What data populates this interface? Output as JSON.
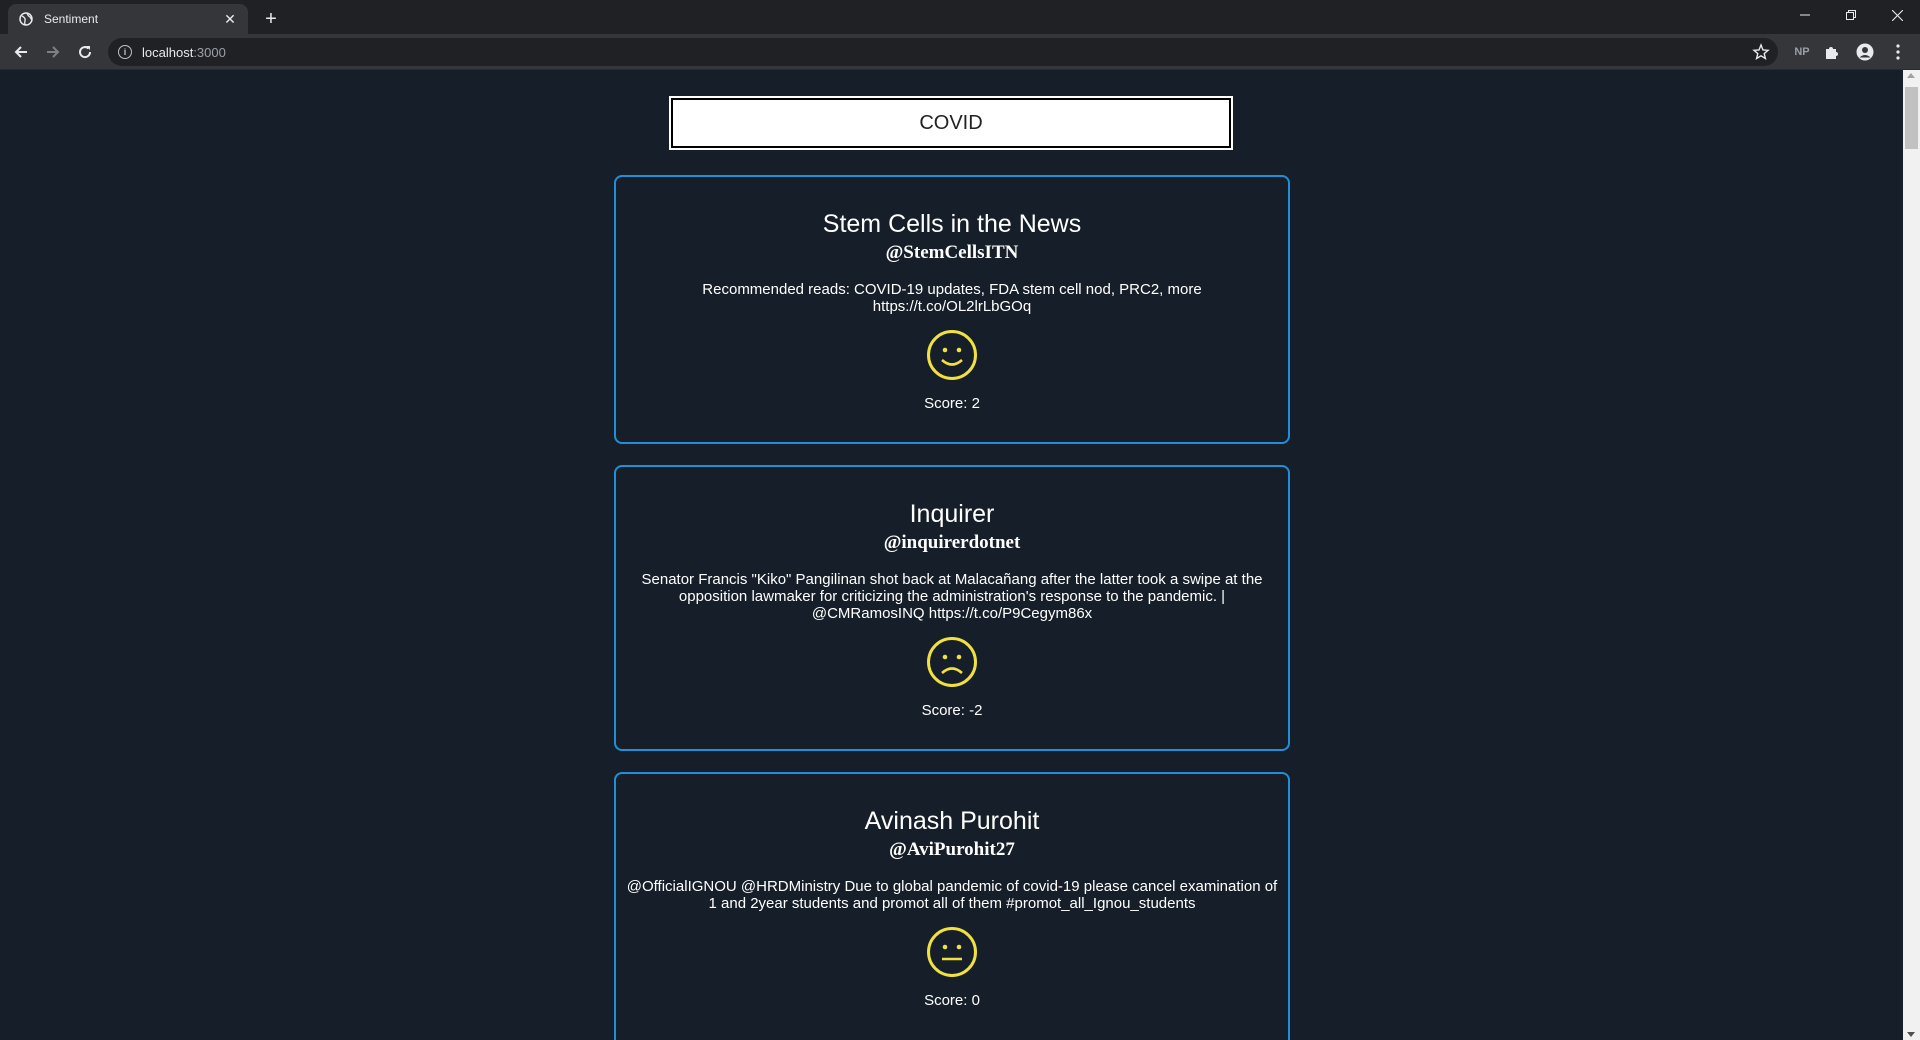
{
  "browser": {
    "tab_title": "Sentiment",
    "url_host": "localhost",
    "url_port": ":3000",
    "profile_badge": "NP"
  },
  "search": {
    "value": "COVID"
  },
  "tweets": [
    {
      "name": "Stem Cells in the News",
      "handle": "@StemCellsITN",
      "text": "Recommended reads: COVID-19 updates, FDA stem cell nod, PRC2, more https://t.co/OL2lrLbGOq",
      "sentiment": "happy",
      "score_label": "Score: 2"
    },
    {
      "name": "Inquirer",
      "handle": "@inquirerdotnet",
      "text": "Senator Francis \"Kiko\" Pangilinan shot back at Malacañang after the latter took a swipe at the opposition lawmaker for criticizing the administration's response to the pandemic. | @CMRamosINQ https://t.co/P9Cegym86x",
      "sentiment": "sad",
      "score_label": "Score: -2"
    },
    {
      "name": "Avinash Purohit",
      "handle": "@AviPurohit27",
      "text": "@OfficialIGNOU @HRDMinistry Due to global pandemic of covid-19 please cancel examination of 1 and 2year students and promot all of them #promot_all_Ignou_students",
      "sentiment": "neutral",
      "score_label": "Score: 0"
    }
  ],
  "colors": {
    "page_bg": "#161f29",
    "card_border": "#1f8fd8",
    "face": "#f0e040"
  }
}
